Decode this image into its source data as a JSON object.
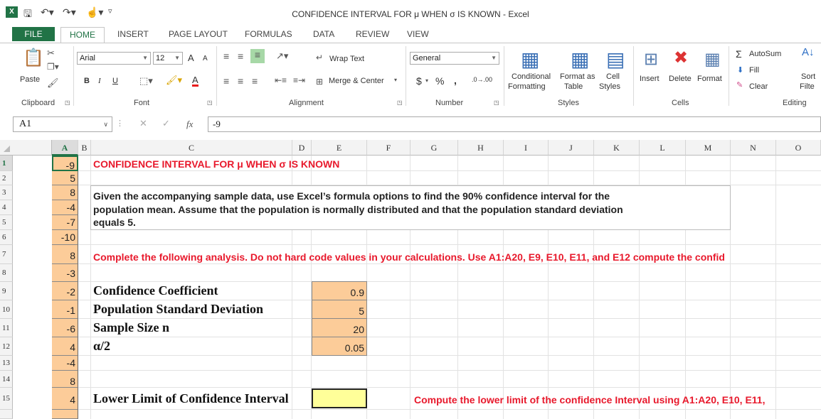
{
  "window": {
    "title": "CONFIDENCE INTERVAL FOR μ WHEN σ IS KNOWN - Excel",
    "app_icon": "X"
  },
  "tabs": [
    "FILE",
    "HOME",
    "INSERT",
    "PAGE LAYOUT",
    "FORMULAS",
    "DATA",
    "REVIEW",
    "VIEW"
  ],
  "ribbon": {
    "clipboard": {
      "paste": "Paste",
      "label": "Clipboard"
    },
    "font": {
      "name": "Arial",
      "size": "12",
      "bold": "B",
      "italic": "I",
      "underline": "U",
      "grow": "A",
      "shrink": "A",
      "color": "A",
      "label": "Font"
    },
    "alignment": {
      "wrap": "Wrap Text",
      "merge": "Merge & Center",
      "label": "Alignment"
    },
    "number": {
      "format": "General",
      "currency": "$",
      "percent": "%",
      "comma": ",",
      "inc": ".0→.00",
      "label": "Number"
    },
    "styles": {
      "conditional1": "Conditional",
      "conditional2": "Formatting",
      "table1": "Format as",
      "table2": "Table",
      "cell1": "Cell",
      "cell2": "Styles",
      "label": "Styles"
    },
    "cells": {
      "insert": "Insert",
      "delete": "Delete",
      "format": "Format",
      "label": "Cells"
    },
    "editing": {
      "autosum": "AutoSum",
      "fill": "Fill",
      "clear": "Clear",
      "sort1": "Sort",
      "sort2": "Filte",
      "label": "Editing"
    }
  },
  "formula_bar": {
    "name_box": "A1",
    "fx": "fx",
    "value": "-9"
  },
  "columns": [
    "A",
    "B",
    "C",
    "D",
    "E",
    "F",
    "G",
    "H",
    "I",
    "J",
    "K",
    "L",
    "M",
    "N",
    "O"
  ],
  "rows": [
    "1",
    "2",
    "3",
    "4",
    "5",
    "6",
    "7",
    "8",
    "9",
    "10",
    "11",
    "12",
    "13",
    "14",
    "15"
  ],
  "column_a": [
    "-9",
    "5",
    "8",
    "-4",
    "-7",
    "-10",
    "8",
    "-3",
    "-2",
    "-1",
    "-6",
    "4",
    "-4",
    "8",
    "4"
  ],
  "sheet": {
    "title": "CONFIDENCE INTERVAL FOR μ WHEN σ IS KNOWN",
    "given1": "Given the accompanying sample data, use Excel’s formula options to find the 90% confidence interval for the",
    "given2": "population mean. Assume that the population is normally distributed and that the population standard deviation",
    "given3": "equals 5.",
    "instruction": "Complete the following analysis. Do not hard code values in your calculations.  Use A1:A20, E9, E10, E11, and E12 compute the confid",
    "labels": [
      "Confidence Coefficient",
      "Population Standard Deviation",
      "Sample Size n",
      "α/2"
    ],
    "values": [
      "0.9",
      "5",
      "20",
      "0.05"
    ],
    "lower_label": "Lower Limit of Confidence Interval",
    "lower_note": "Compute the lower limit of the confidence Interval using A1:A20, E10, E11,"
  },
  "colors": {
    "excel_green": "#217346",
    "cell_fill": "#fccc99",
    "input_fill": "#ffff99",
    "red_text": "#e8192c"
  }
}
